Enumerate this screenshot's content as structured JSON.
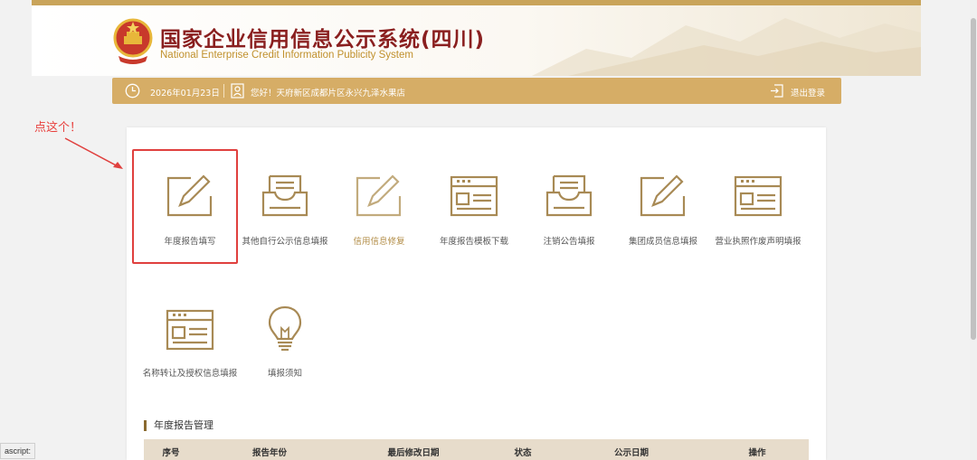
{
  "header": {
    "title_zh": "国家企业信用信息公示系统(四川)",
    "title_en": "National Enterprise Credit Information Publicity System",
    "emblem_icon": "national-emblem-icon"
  },
  "info_bar": {
    "date": "2026年01月23日",
    "greeting": "您好！天府新区成都片区永兴九泽水果店",
    "logout": "退出登录"
  },
  "annotation": {
    "text": "点这个！"
  },
  "tiles": [
    {
      "label": "年度报告填写",
      "icon": "edit-icon"
    },
    {
      "label": "其他自行公示信息填报",
      "icon": "inbox-icon"
    },
    {
      "label": "信用信息修复",
      "icon": "edit-icon"
    },
    {
      "label": "年度报告模板下载",
      "icon": "form-icon"
    },
    {
      "label": "注销公告填报",
      "icon": "inbox-icon"
    },
    {
      "label": "集团成员信息填报",
      "icon": "edit-icon"
    },
    {
      "label": "营业执照作废声明填报",
      "icon": "form-icon"
    },
    {
      "label": "名称转让及授权信息填报",
      "icon": "form-icon"
    },
    {
      "label": "填报须知",
      "icon": "lightbulb-icon"
    }
  ],
  "annual_reports": {
    "section_title": "年度报告管理",
    "columns": [
      "序号",
      "报告年份",
      "最后修改日期",
      "状态",
      "公示日期",
      "操作"
    ]
  },
  "status_bar": {
    "text": "ascript:"
  },
  "colors": {
    "gold": "#c9a45a",
    "info_bar": "#d6ad66",
    "highlight_red": "#e0403e",
    "title_red": "#8a1f1f"
  }
}
